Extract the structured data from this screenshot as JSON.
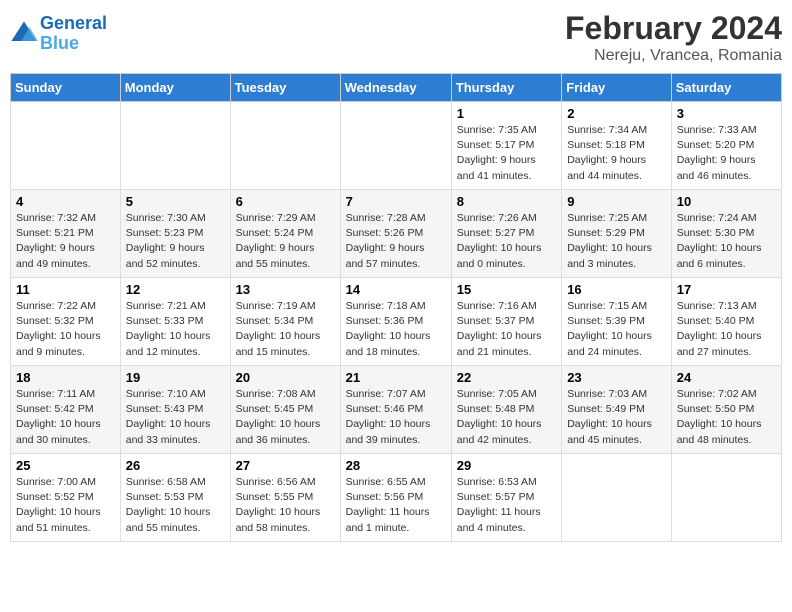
{
  "header": {
    "logo_line1": "General",
    "logo_line2": "Blue",
    "month_year": "February 2024",
    "location": "Nereju, Vrancea, Romania"
  },
  "days_of_week": [
    "Sunday",
    "Monday",
    "Tuesday",
    "Wednesday",
    "Thursday",
    "Friday",
    "Saturday"
  ],
  "weeks": [
    [
      {
        "day": "",
        "info": ""
      },
      {
        "day": "",
        "info": ""
      },
      {
        "day": "",
        "info": ""
      },
      {
        "day": "",
        "info": ""
      },
      {
        "day": "1",
        "info": "Sunrise: 7:35 AM\nSunset: 5:17 PM\nDaylight: 9 hours\nand 41 minutes."
      },
      {
        "day": "2",
        "info": "Sunrise: 7:34 AM\nSunset: 5:18 PM\nDaylight: 9 hours\nand 44 minutes."
      },
      {
        "day": "3",
        "info": "Sunrise: 7:33 AM\nSunset: 5:20 PM\nDaylight: 9 hours\nand 46 minutes."
      }
    ],
    [
      {
        "day": "4",
        "info": "Sunrise: 7:32 AM\nSunset: 5:21 PM\nDaylight: 9 hours\nand 49 minutes."
      },
      {
        "day": "5",
        "info": "Sunrise: 7:30 AM\nSunset: 5:23 PM\nDaylight: 9 hours\nand 52 minutes."
      },
      {
        "day": "6",
        "info": "Sunrise: 7:29 AM\nSunset: 5:24 PM\nDaylight: 9 hours\nand 55 minutes."
      },
      {
        "day": "7",
        "info": "Sunrise: 7:28 AM\nSunset: 5:26 PM\nDaylight: 9 hours\nand 57 minutes."
      },
      {
        "day": "8",
        "info": "Sunrise: 7:26 AM\nSunset: 5:27 PM\nDaylight: 10 hours\nand 0 minutes."
      },
      {
        "day": "9",
        "info": "Sunrise: 7:25 AM\nSunset: 5:29 PM\nDaylight: 10 hours\nand 3 minutes."
      },
      {
        "day": "10",
        "info": "Sunrise: 7:24 AM\nSunset: 5:30 PM\nDaylight: 10 hours\nand 6 minutes."
      }
    ],
    [
      {
        "day": "11",
        "info": "Sunrise: 7:22 AM\nSunset: 5:32 PM\nDaylight: 10 hours\nand 9 minutes."
      },
      {
        "day": "12",
        "info": "Sunrise: 7:21 AM\nSunset: 5:33 PM\nDaylight: 10 hours\nand 12 minutes."
      },
      {
        "day": "13",
        "info": "Sunrise: 7:19 AM\nSunset: 5:34 PM\nDaylight: 10 hours\nand 15 minutes."
      },
      {
        "day": "14",
        "info": "Sunrise: 7:18 AM\nSunset: 5:36 PM\nDaylight: 10 hours\nand 18 minutes."
      },
      {
        "day": "15",
        "info": "Sunrise: 7:16 AM\nSunset: 5:37 PM\nDaylight: 10 hours\nand 21 minutes."
      },
      {
        "day": "16",
        "info": "Sunrise: 7:15 AM\nSunset: 5:39 PM\nDaylight: 10 hours\nand 24 minutes."
      },
      {
        "day": "17",
        "info": "Sunrise: 7:13 AM\nSunset: 5:40 PM\nDaylight: 10 hours\nand 27 minutes."
      }
    ],
    [
      {
        "day": "18",
        "info": "Sunrise: 7:11 AM\nSunset: 5:42 PM\nDaylight: 10 hours\nand 30 minutes."
      },
      {
        "day": "19",
        "info": "Sunrise: 7:10 AM\nSunset: 5:43 PM\nDaylight: 10 hours\nand 33 minutes."
      },
      {
        "day": "20",
        "info": "Sunrise: 7:08 AM\nSunset: 5:45 PM\nDaylight: 10 hours\nand 36 minutes."
      },
      {
        "day": "21",
        "info": "Sunrise: 7:07 AM\nSunset: 5:46 PM\nDaylight: 10 hours\nand 39 minutes."
      },
      {
        "day": "22",
        "info": "Sunrise: 7:05 AM\nSunset: 5:48 PM\nDaylight: 10 hours\nand 42 minutes."
      },
      {
        "day": "23",
        "info": "Sunrise: 7:03 AM\nSunset: 5:49 PM\nDaylight: 10 hours\nand 45 minutes."
      },
      {
        "day": "24",
        "info": "Sunrise: 7:02 AM\nSunset: 5:50 PM\nDaylight: 10 hours\nand 48 minutes."
      }
    ],
    [
      {
        "day": "25",
        "info": "Sunrise: 7:00 AM\nSunset: 5:52 PM\nDaylight: 10 hours\nand 51 minutes."
      },
      {
        "day": "26",
        "info": "Sunrise: 6:58 AM\nSunset: 5:53 PM\nDaylight: 10 hours\nand 55 minutes."
      },
      {
        "day": "27",
        "info": "Sunrise: 6:56 AM\nSunset: 5:55 PM\nDaylight: 10 hours\nand 58 minutes."
      },
      {
        "day": "28",
        "info": "Sunrise: 6:55 AM\nSunset: 5:56 PM\nDaylight: 11 hours\nand 1 minute."
      },
      {
        "day": "29",
        "info": "Sunrise: 6:53 AM\nSunset: 5:57 PM\nDaylight: 11 hours\nand 4 minutes."
      },
      {
        "day": "",
        "info": ""
      },
      {
        "day": "",
        "info": ""
      }
    ]
  ]
}
